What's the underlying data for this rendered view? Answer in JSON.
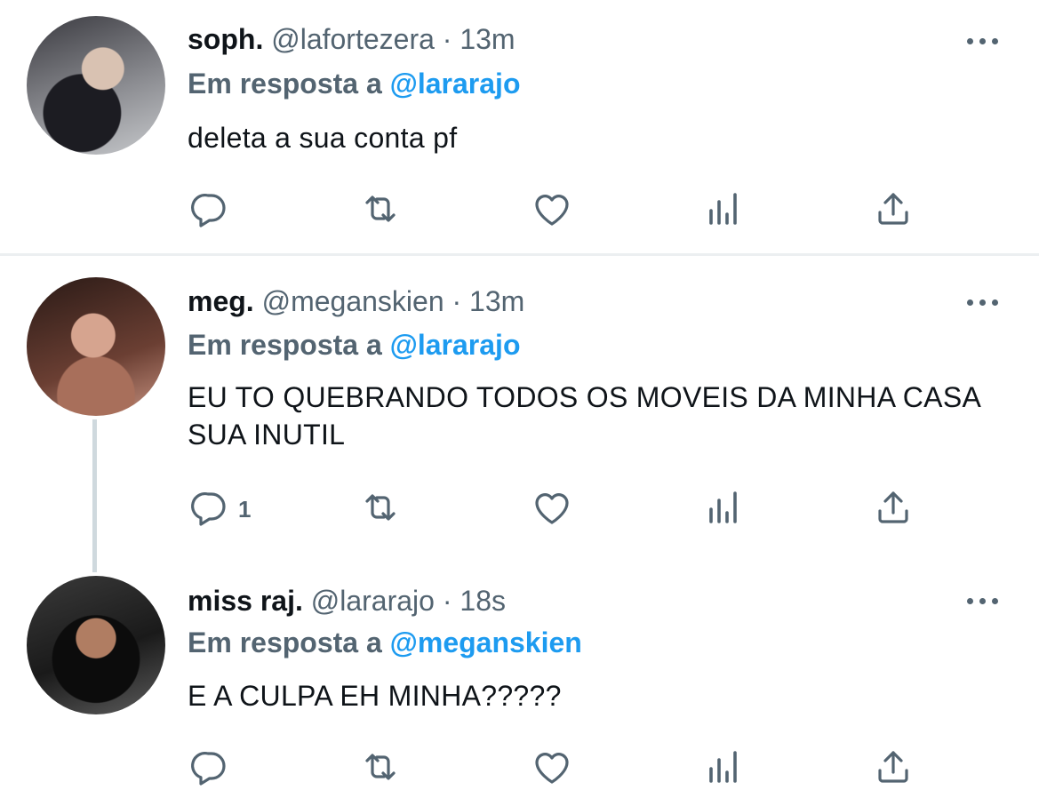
{
  "tweets": [
    {
      "name": "soph.",
      "handle": "@lafortezera",
      "dot": "·",
      "time": "13m",
      "reply_prefix": "Em resposta a",
      "reply_to": "@lararajo",
      "text": "deleta a sua conta pf",
      "reply_count": ""
    },
    {
      "name": "meg.",
      "handle": "@meganskien",
      "dot": "·",
      "time": "13m",
      "reply_prefix": "Em resposta a",
      "reply_to": "@lararajo",
      "text": "EU TO QUEBRANDO TODOS OS MOVEIS DA MINHA CASA SUA INUTIL",
      "reply_count": "1"
    },
    {
      "name": "miss raj.",
      "handle": "@lararajo",
      "dot": "·",
      "time": "18s",
      "reply_prefix": "Em resposta a",
      "reply_to": "@meganskien",
      "text": "E A CULPA EH MINHA?????",
      "reply_count": ""
    }
  ],
  "icons": {
    "reply": "reply-icon",
    "retweet": "retweet-icon",
    "like": "heart-icon",
    "views": "views-icon",
    "share": "share-icon",
    "more": "more-icon"
  },
  "colors": {
    "icon": "#536471",
    "mention": "#1d9bf0",
    "text": "#0f1419"
  }
}
